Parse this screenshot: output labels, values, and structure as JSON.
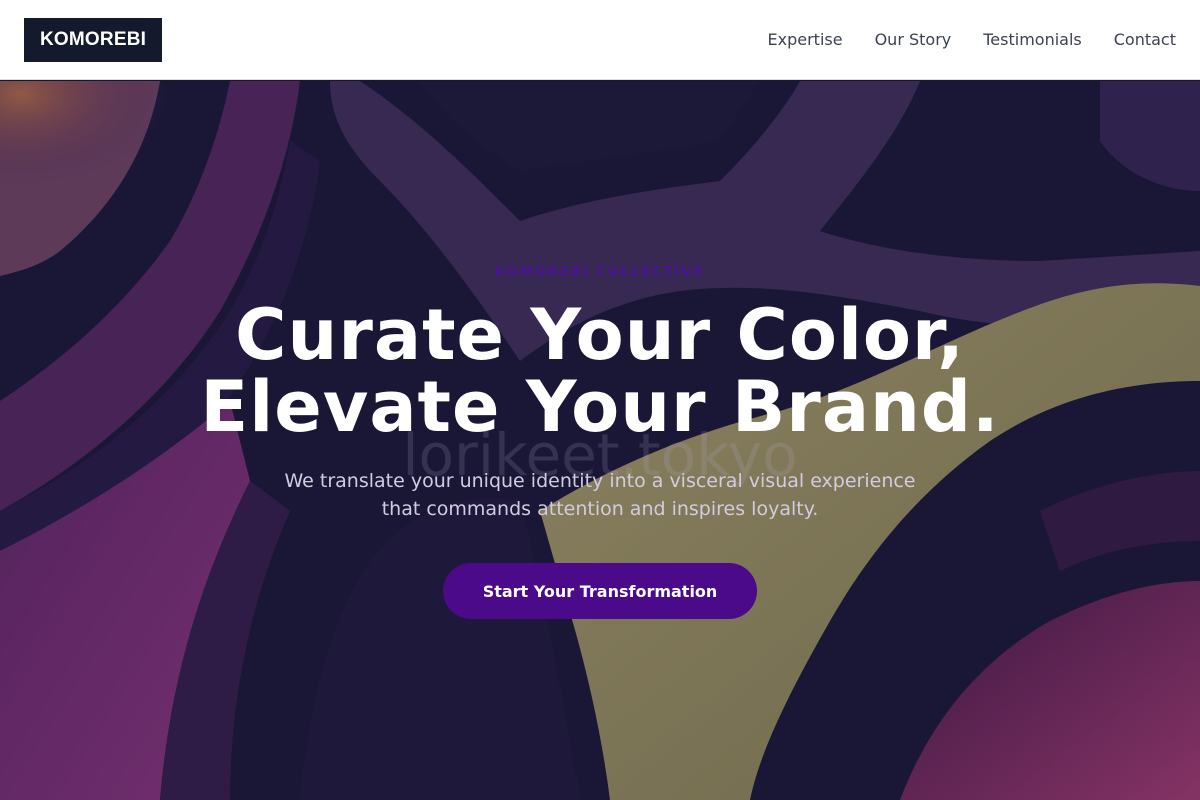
{
  "header": {
    "logo": "KOMOREBI",
    "nav": [
      {
        "label": "Expertise"
      },
      {
        "label": "Our Story"
      },
      {
        "label": "Testimonials"
      },
      {
        "label": "Contact"
      }
    ]
  },
  "hero": {
    "eyebrow": "KOMOREBI COLLECTIVE",
    "headline_line1": "Curate Your Color,",
    "headline_line2": "Elevate Your Brand.",
    "watermark": "lorikeet.tokyo",
    "subtext_line1": "We translate your unique identity into a visceral visual experience",
    "subtext_line2": "that commands attention and inspires loyalty.",
    "cta": "Start Your Transformation"
  },
  "colors": {
    "header_bg": "#ffffff",
    "logo_bg": "#131a2c",
    "accent_purple": "#4a0a8a",
    "hero_dark": "#1c1a3a",
    "hero_olive": "#a8a06a",
    "hero_magenta": "#7a2a6a"
  }
}
